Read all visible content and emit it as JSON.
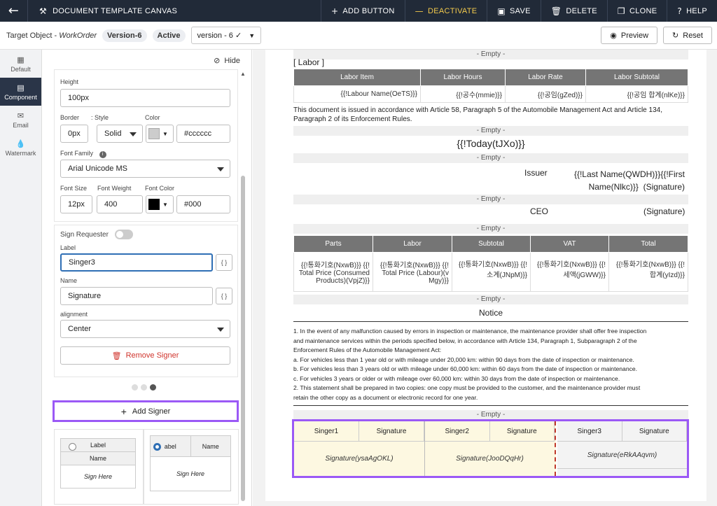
{
  "topbar": {
    "title": "DOCUMENT TEMPLATE CANVAS",
    "actions": {
      "add_button": "ADD BUTTON",
      "deactivate": "DEACTIVATE",
      "save": "SAVE",
      "delete": "DELETE",
      "clone": "CLONE",
      "help": "HELP"
    }
  },
  "subbar": {
    "target_label": "Target Object - ",
    "target_value": "WorkOrder",
    "version_badge": "Version-6",
    "status_badge": "Active",
    "version_select": "version - 6 ✓",
    "preview": "Preview",
    "reset": "Reset"
  },
  "leftnav": [
    "Default",
    "Component",
    "Email",
    "Watermark"
  ],
  "panel": {
    "hide": "Hide",
    "height_label": "Height",
    "height_value": "100px",
    "border_label": "Border",
    "style_label": ": Style",
    "color_label": "Color",
    "border_value": "0px",
    "style_value": "Solid",
    "border_color": "#cccccc",
    "font_family_label": "Font Family",
    "font_family_value": "Arial Unicode MS",
    "font_size_label": "Font Size",
    "font_weight_label": "Font Weight",
    "font_color_label": "Font Color",
    "font_size_value": "12px",
    "font_weight_value": "400",
    "font_color_value": "#000",
    "sign_requester_label": "Sign Requester",
    "label_label": "Label",
    "label_value": "Singer3",
    "name_label": "Name",
    "name_value": "Signature",
    "alignment_label": "alignment",
    "alignment_value": "Center",
    "remove_signer": "Remove Signer",
    "add_signer": "Add Signer",
    "tmpl1": {
      "label": "Label",
      "name": "Name",
      "sign": "Sign Here"
    },
    "tmpl2": {
      "label": "abel",
      "name": "Name",
      "sign": "Sign Here"
    }
  },
  "doc": {
    "empty": "- Empty -",
    "labor_title": "[ Labor ]",
    "labor_headers": [
      "Labor Item",
      "Labor Hours",
      "Labor Rate",
      "Labor Subtotal"
    ],
    "labor_row": [
      "{{!Labour Name(OeTS)}}",
      "{{!공수(mmie)}}",
      "{{!공임(gZed)}}",
      "{{!공임 합계(nlKe)}}"
    ],
    "article_text_1": "This document is issued in accordance with Article 58, Paragraph 5 of the Automobile Management Act and Article 134,",
    "article_text_2": "Paragraph 2 of its Enforcement Rules.",
    "today": "{{!Today(tJXo)}}",
    "issuer": "Issuer",
    "issuer_name_1": "{{!Last Name(QWDH)}}{{!First",
    "issuer_name_2": "Name(Nlkc)}}",
    "signature_paren": "(Signature)",
    "ceo": "CEO",
    "totals_headers": [
      "Parts",
      "Labor",
      "Subtotal",
      "VAT",
      "Total"
    ],
    "totals_row": [
      [
        "{{!통화기호(NxwB)}} {{!",
        "Total Price (Consumed",
        "Products)(VpjZ)}}"
      ],
      [
        "{{!통화기호(NxwB)}} {{!",
        "Total Price (Labour)(v",
        "Mgy)}}"
      ],
      [
        "{{!통화기호(NxwB)}} {{!",
        "소계(JNpM)}}",
        ""
      ],
      [
        "{{!통화기호(NxwB)}} {{!",
        "세액(jGWW)}}",
        ""
      ],
      [
        "{{!통화기호(NxwB)}} {{!",
        "합계(yIzd)}}",
        ""
      ]
    ],
    "notice": "Notice",
    "notice_lines": [
      "1. In the event of any malfunction caused by errors in inspection or maintenance, the maintenance provider shall offer free inspection",
      "and maintenance services within the periods specified below, in accordance with Article 134, Paragraph 1, Subparagraph 2 of the",
      "Enforcement Rules of the Automobile Management Act:",
      "a. For vehicles less than 1 year old or with mileage under 20,000 km: within 90 days from the date of inspection or maintenance.",
      "b. For vehicles less than 3 years old or with mileage under 60,000 km: within 60 days from the date of inspection or maintenance.",
      "c. For vehicles 3 years or older or with mileage over 60,000 km: within 30 days from the date of inspection or maintenance.",
      "2. This statement shall be prepared in two copies: one copy must be provided to the customer, and the maintenance provider must",
      "retain the other copy as a document or electronic record for one year."
    ],
    "signers": [
      {
        "label": "Singer1",
        "name": "Signature",
        "value": "Signature(ysaAgOKL)"
      },
      {
        "label": "Singer2",
        "name": "Signature",
        "value": "Signature(JooDQqHr)"
      },
      {
        "label": "Singer3",
        "name": "Signature",
        "value": "Signature(eRkAAqvm)"
      }
    ]
  },
  "colors": {
    "topbar": "#212a38",
    "accent_purple": "#9b59f6",
    "deactivate": "#f2c94c",
    "remove": "#d0342c",
    "signer_bg": "#fdf8e1"
  }
}
